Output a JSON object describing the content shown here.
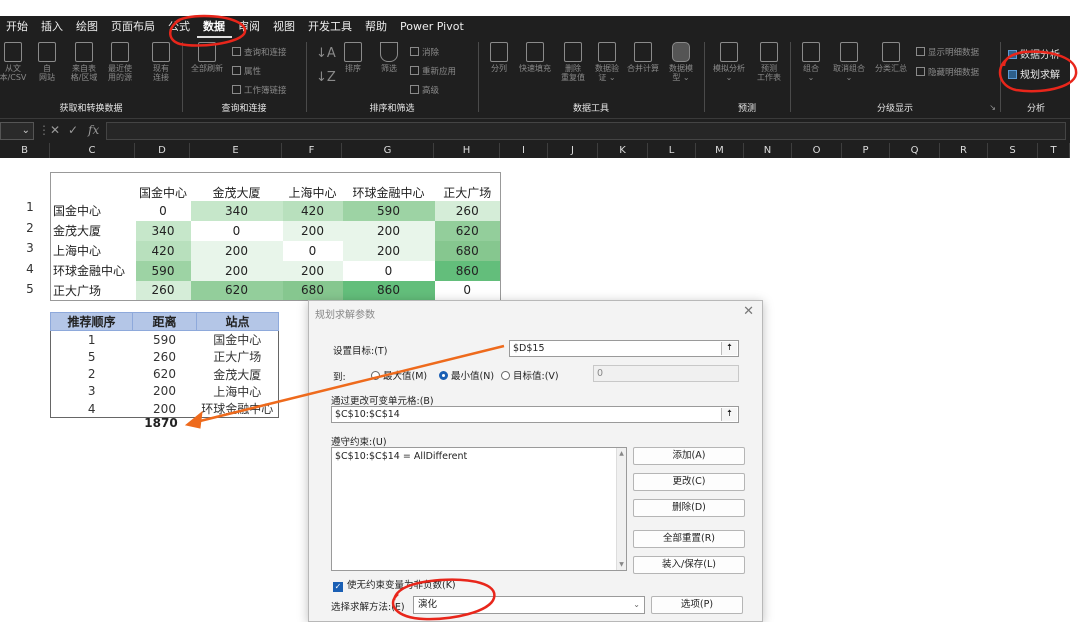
{
  "ribbon": {
    "menu": [
      "开始",
      "插入",
      "绘图",
      "页面布局",
      "公式",
      "数据",
      "审阅",
      "视图",
      "开发工具",
      "帮助",
      "Power Pivot"
    ],
    "active_tab": "数据",
    "groups": {
      "get_data": {
        "label": "获取和转换数据",
        "buttons": [
          "从文\n本/CSV",
          "自\n网站",
          "来自表\n格/区域",
          "最近使\n用的源",
          "现有\n连接"
        ]
      },
      "queries": {
        "label": "查询和连接",
        "refresh": "全部刷新",
        "items": [
          "查询和连接",
          "属性",
          "工作簿链接"
        ]
      },
      "sort_filter": {
        "label": "排序和筛选",
        "sort": "排序",
        "filter": "筛选",
        "items": [
          "消除",
          "重新应用",
          "高级"
        ]
      },
      "data_tools": {
        "label": "数据工具",
        "buttons": [
          "分列",
          "快速填充",
          "删除\n重复值",
          "数据验\n证 ⌄",
          "合并计算",
          "数据模\n型 ⌄"
        ]
      },
      "forecast": {
        "label": "预测",
        "buttons": [
          "模拟分析\n⌄",
          "预测\n工作表"
        ]
      },
      "outline": {
        "label": "分级显示",
        "buttons": [
          "组合\n⌄",
          "取消组合\n⌄",
          "分类汇总"
        ],
        "items": [
          "显示明细数据",
          "隐藏明细数据"
        ]
      },
      "analysis": {
        "label": "分析",
        "items": [
          "数据分析",
          "规划求解"
        ]
      }
    }
  },
  "formula_bar": {
    "fx": "fx"
  },
  "columns": [
    "B",
    "C",
    "D",
    "E",
    "F",
    "G",
    "H",
    "I",
    "J",
    "K",
    "L",
    "M",
    "N",
    "O",
    "P",
    "Q",
    "R",
    "S",
    "T"
  ],
  "matrix": {
    "headers": [
      "国金中心",
      "金茂大厦",
      "上海中心",
      "环球金融中心",
      "正大广场"
    ],
    "row_numbers": [
      "1",
      "2",
      "3",
      "4",
      "5"
    ],
    "rows": [
      {
        "label": "国金中心",
        "values": [
          "0",
          "340",
          "420",
          "590",
          "260"
        ]
      },
      {
        "label": "金茂大厦",
        "values": [
          "340",
          "0",
          "200",
          "200",
          "620"
        ]
      },
      {
        "label": "上海中心",
        "values": [
          "420",
          "200",
          "0",
          "200",
          "680"
        ]
      },
      {
        "label": "环球金融中心",
        "values": [
          "590",
          "200",
          "200",
          "0",
          "860"
        ]
      },
      {
        "label": "正大广场",
        "values": [
          "260",
          "620",
          "680",
          "860",
          "0"
        ]
      }
    ],
    "heat_colors": {
      "0": "#ffffff",
      "200": "#e8f5ea",
      "260": "#d5edd8",
      "340": "#c6e7ca",
      "420": "#b8e0bd",
      "590": "#9dd3a4",
      "620": "#93ce9b",
      "680": "#86c78f",
      "860": "#63be7b"
    }
  },
  "route": {
    "headers": [
      "推荐顺序",
      "距离",
      "站点"
    ],
    "rows": [
      [
        "1",
        "590",
        "国金中心"
      ],
      [
        "5",
        "260",
        "正大广场"
      ],
      [
        "2",
        "620",
        "金茂大厦"
      ],
      [
        "3",
        "200",
        "上海中心"
      ],
      [
        "4",
        "200",
        "环球金融中心"
      ]
    ],
    "total": "1870"
  },
  "solver": {
    "title": "规划求解参数",
    "close": "✕",
    "target_label": "设置目标:(T)",
    "target_value": "$D$15",
    "to_label": "到:",
    "options": [
      "最大值(M)",
      "最小值(N)",
      "目标值:(V)"
    ],
    "selected_option": "最小值(N)",
    "target_val_input": "0",
    "changing_label": "通过更改可变单元格:(B)",
    "changing_value": "$C$10:$C$14",
    "constraints_label": "遵守约束:(U)",
    "constraints": [
      "$C$10:$C$14 = AllDifferent"
    ],
    "buttons": [
      "添加(A)",
      "更改(C)",
      "删除(D)",
      "全部重置(R)",
      "装入/保存(L)"
    ],
    "nonneg_label": "使无约束变量为非负数(K)",
    "method_label": "选择求解方法:(E)",
    "method_value": "演化",
    "options_button": "选项(P)"
  },
  "annotations": {
    "color": "#e8261b",
    "arrow_color": "#ee6a1c"
  }
}
